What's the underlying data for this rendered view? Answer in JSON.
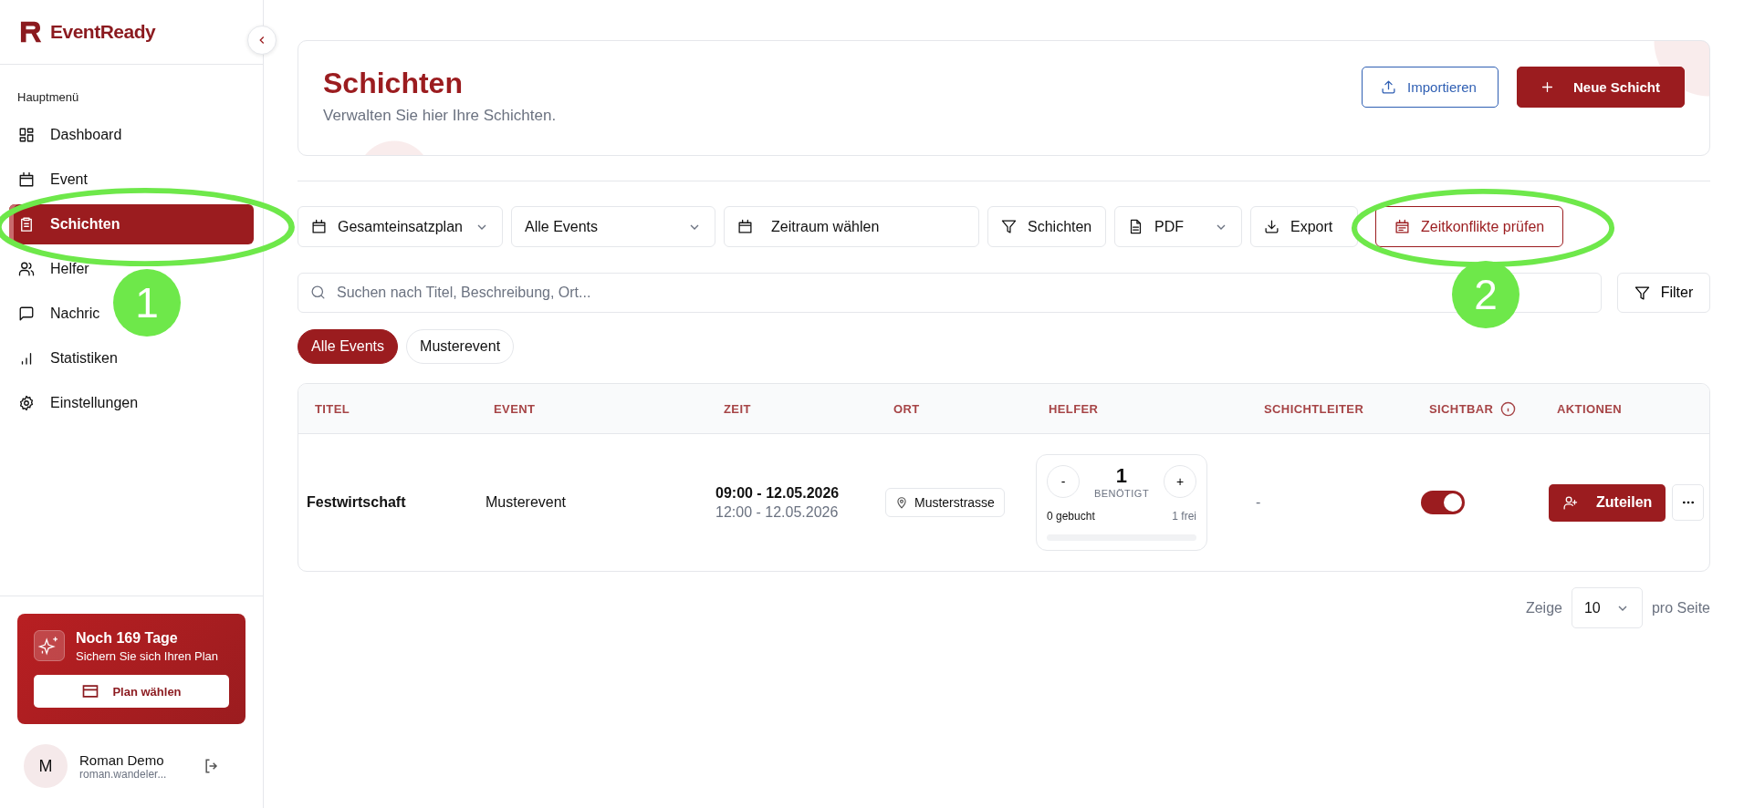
{
  "brand": {
    "name": "EventReady"
  },
  "sidebar": {
    "section": "Hauptmenü",
    "items": [
      {
        "label": "Dashboard",
        "selected": false
      },
      {
        "label": "Event",
        "selected": false
      },
      {
        "label": "Schichten",
        "selected": true
      },
      {
        "label": "Helfer",
        "selected": false
      },
      {
        "label": "Nachric",
        "selected": false
      },
      {
        "label": "Statistiken",
        "selected": false
      },
      {
        "label": "Einstellungen",
        "selected": false
      }
    ],
    "promo": {
      "title": "Noch 169 Tage",
      "subtitle": "Sichern Sie sich Ihren Plan",
      "button": "Plan wählen"
    },
    "user": {
      "initial": "M",
      "name": "Roman Demo",
      "email": "roman.wandeler..."
    }
  },
  "header": {
    "title": "Schichten",
    "subtitle": "Verwalten Sie hier Ihre Schichten.",
    "buttons": [
      {
        "label": "Importieren",
        "kind": "outline"
      },
      {
        "label": "Neue Schicht",
        "kind": "primary"
      }
    ]
  },
  "toolbar": [
    {
      "label": "Gesamteinsatzplan",
      "dropdown": true,
      "kind": "plain"
    },
    {
      "label": "Alle Events",
      "dropdown": true,
      "kind": "plain"
    },
    {
      "label": "Zeitraum wählen",
      "dropdown": false,
      "kind": "plain"
    },
    {
      "label": "Schichten",
      "dropdown": false,
      "kind": "plain"
    },
    {
      "label": "PDF",
      "dropdown": true,
      "kind": "plain"
    },
    {
      "label": "Export",
      "dropdown": false,
      "kind": "plain"
    },
    {
      "label": "Zeitkonflikte prüfen",
      "dropdown": false,
      "kind": "danger"
    }
  ],
  "search": {
    "placeholder": "Suchen nach Titel, Beschreibung, Ort..."
  },
  "filter_button": "Filter",
  "chips": [
    {
      "label": "Alle Events",
      "selected": true
    },
    {
      "label": "Musterevent",
      "selected": false
    }
  ],
  "table": {
    "columns": [
      {
        "label": "TITEL"
      },
      {
        "label": "EVENT"
      },
      {
        "label": "ZEIT"
      },
      {
        "label": "ORT"
      },
      {
        "label": "HELFER"
      },
      {
        "label": "SCHICHTLEITER"
      },
      {
        "label": "SICHTBAR"
      },
      {
        "label": "AKTIONEN"
      }
    ],
    "rows": [
      {
        "title": "Festwirtschaft",
        "event": "Musterevent",
        "start": "09:00 - 12.05.2026",
        "end": "12:00 - 12.05.2026",
        "location": "Musterstrasse",
        "helpers": {
          "needed": "1",
          "needed_label": "BENÖTIGT",
          "minus": "-",
          "plus": "+",
          "booked": "0 gebucht",
          "free": "1 frei",
          "level": 0
        },
        "lead": "-",
        "visible": true,
        "action": "Zuteilen"
      }
    ]
  },
  "pagination": {
    "prefix": "Zeige",
    "value": "10",
    "suffix": "pro Seite"
  },
  "annotations": [
    {
      "label": "1"
    },
    {
      "label": "2"
    }
  ]
}
